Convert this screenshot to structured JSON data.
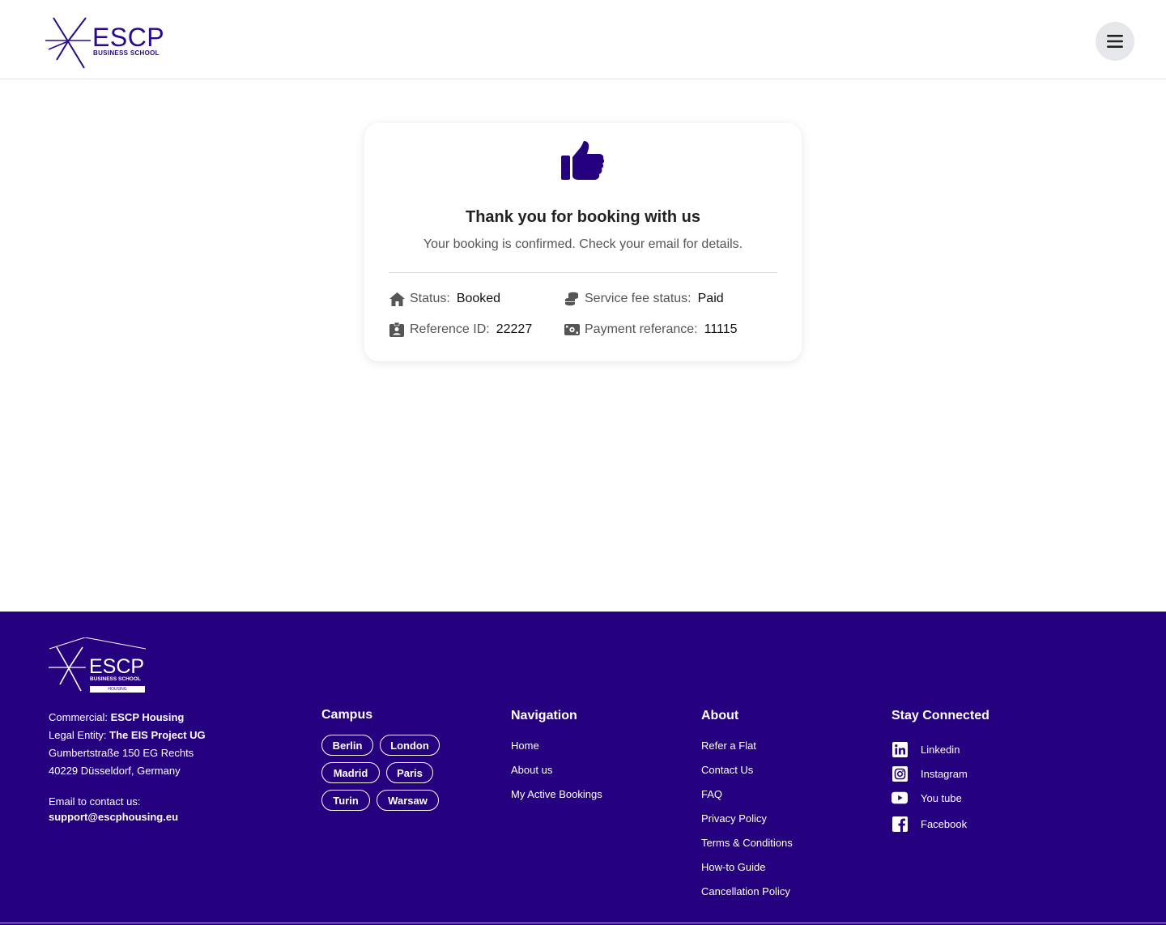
{
  "header": {
    "logo_text": "ESCP",
    "logo_subtext": "BUSINESS SCHOOL",
    "menu_icon": "hamburger-menu-icon"
  },
  "confirmation": {
    "icon": "thumbs-up-icon",
    "title": "Thank you for booking with us",
    "subtitle": "Your booking is confirmed. Check your email for details.",
    "status_label": "Status:",
    "status_value": "Booked",
    "fee_label": "Service fee status:",
    "fee_value": "Paid",
    "reference_label": "Reference ID:",
    "reference_value": "22227",
    "payment_label": "Payment referance:",
    "payment_value": "11115"
  },
  "footer": {
    "logo_text": "ESCP",
    "logo_subtext": "BUSINESS SCHOOL",
    "logo_badge": "HOUSING",
    "commercial_label": "Commercial:",
    "commercial_value": "ESCP Housing",
    "legal_label": "Legal Entity:",
    "legal_value": "The EIS Project UG",
    "address_line1": "Gumbertstraße 150 EG Rechts",
    "address_line2": "40229 Düsseldorf, Germany",
    "email_label": "Email to contact us:",
    "email_value": "support@escphousing.eu",
    "campus_title": "Campus",
    "campus": [
      "Berlin",
      "London",
      "Madrid",
      "Paris",
      "Turin",
      "Warsaw"
    ],
    "navigation_title": "Navigation",
    "navigation": [
      "Home",
      "About us",
      "My Active Bookings"
    ],
    "about_title": "About",
    "about": [
      "Refer a Flat",
      "Contact Us",
      "FAQ",
      "Privacy Policy",
      "Terms & Conditions",
      "How-to Guide",
      "Cancellation Policy"
    ],
    "social_title": "Stay Connected",
    "social": [
      "Linkedin",
      "Instagram",
      "You tube",
      "Facebook"
    ]
  },
  "colors": {
    "brand": "#25007f",
    "logo": "#2a0a87"
  }
}
